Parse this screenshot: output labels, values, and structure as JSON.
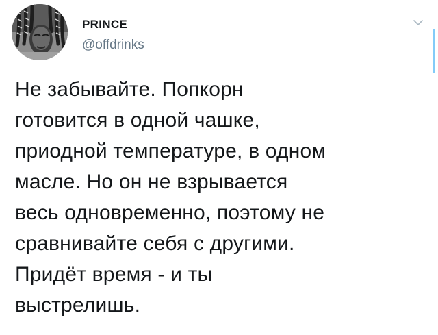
{
  "user": {
    "display_name": "PRINCE",
    "handle": "@offdrinks",
    "avatar_icon": "avatar-photo"
  },
  "menu": {
    "icon": "chevron-down-icon",
    "color": "#aab8c2"
  },
  "tweet": {
    "lines": [
      "Не забывайте. Попкорн",
      "готовится в одной чашке,",
      "приодной температуре, в одном",
      "масле. Но он не взрывается",
      "весь одновременно, поэтому не",
      "сравнивайте себя с другими.",
      "Придёт время - и ты",
      "выстрелишь."
    ]
  },
  "colors": {
    "text": "#14171a",
    "handle": "#657786",
    "accent": "#1da1f2",
    "background": "#ffffff"
  }
}
